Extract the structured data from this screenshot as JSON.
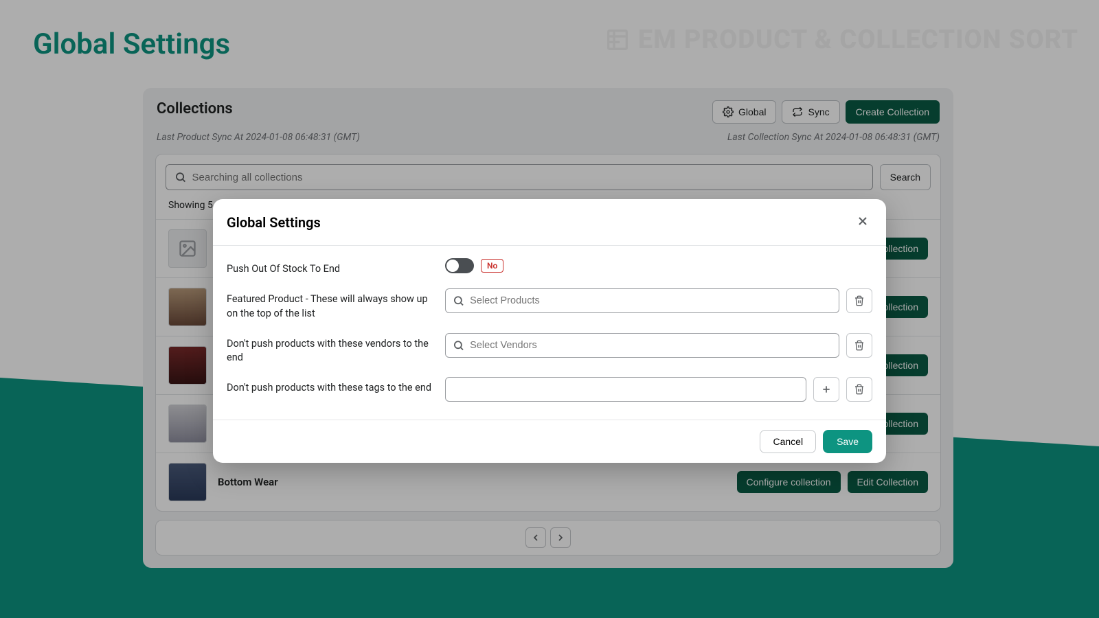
{
  "page": {
    "title": "Global Settings",
    "brand": "EM PRODUCT & COLLECTION SORT"
  },
  "card": {
    "title": "Collections",
    "buttons": {
      "global": "Global",
      "sync": "Sync",
      "create": "Create Collection"
    },
    "last_product_sync": "Last Product Sync At 2024-01-08 06:48:31 (GMT)",
    "last_collection_sync": "Last Collection Sync At 2024-01-08 06:48:31 (GMT)",
    "search_placeholder": "Searching all collections",
    "search_btn": "Search",
    "showing_prefix": "Showing 5",
    "row_actions": {
      "configure": "Configure collection",
      "edit": "Edit Collection"
    },
    "rows": [
      {
        "name": ""
      },
      {
        "name": ""
      },
      {
        "name": ""
      },
      {
        "name": ""
      },
      {
        "name": "Bottom Wear"
      }
    ]
  },
  "modal": {
    "title": "Global Settings",
    "labels": {
      "push_oos": "Push Out Of Stock To End",
      "featured": "Featured Product - These will always show up on the top of the list",
      "vendors": "Don't push products with these vendors to the end",
      "tags": "Don't push products with these tags to the end"
    },
    "placeholders": {
      "products": "Select Products",
      "vendors": "Select Vendors"
    },
    "toggle_badge": "No",
    "footer": {
      "cancel": "Cancel",
      "save": "Save"
    }
  }
}
